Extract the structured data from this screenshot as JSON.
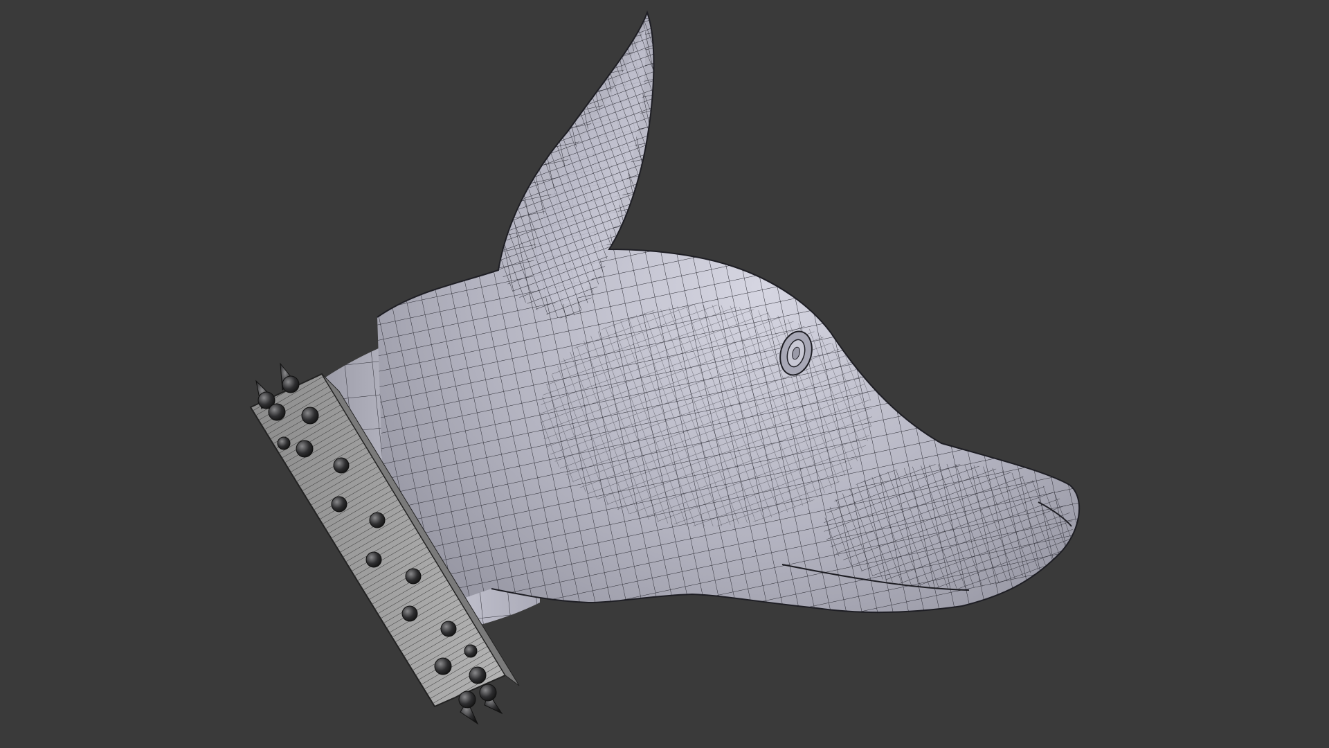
{
  "viewport": {
    "background": "#3a3a3a",
    "mode": "wireframe-on-shaded"
  },
  "model": {
    "subject": "doberman-head",
    "surface_color": "#b9b9c4",
    "wire_color": "#26262c",
    "collar": {
      "band_color": "#9a9a9a",
      "spike_color": "#2a2a2c",
      "spike_count": 18
    }
  }
}
